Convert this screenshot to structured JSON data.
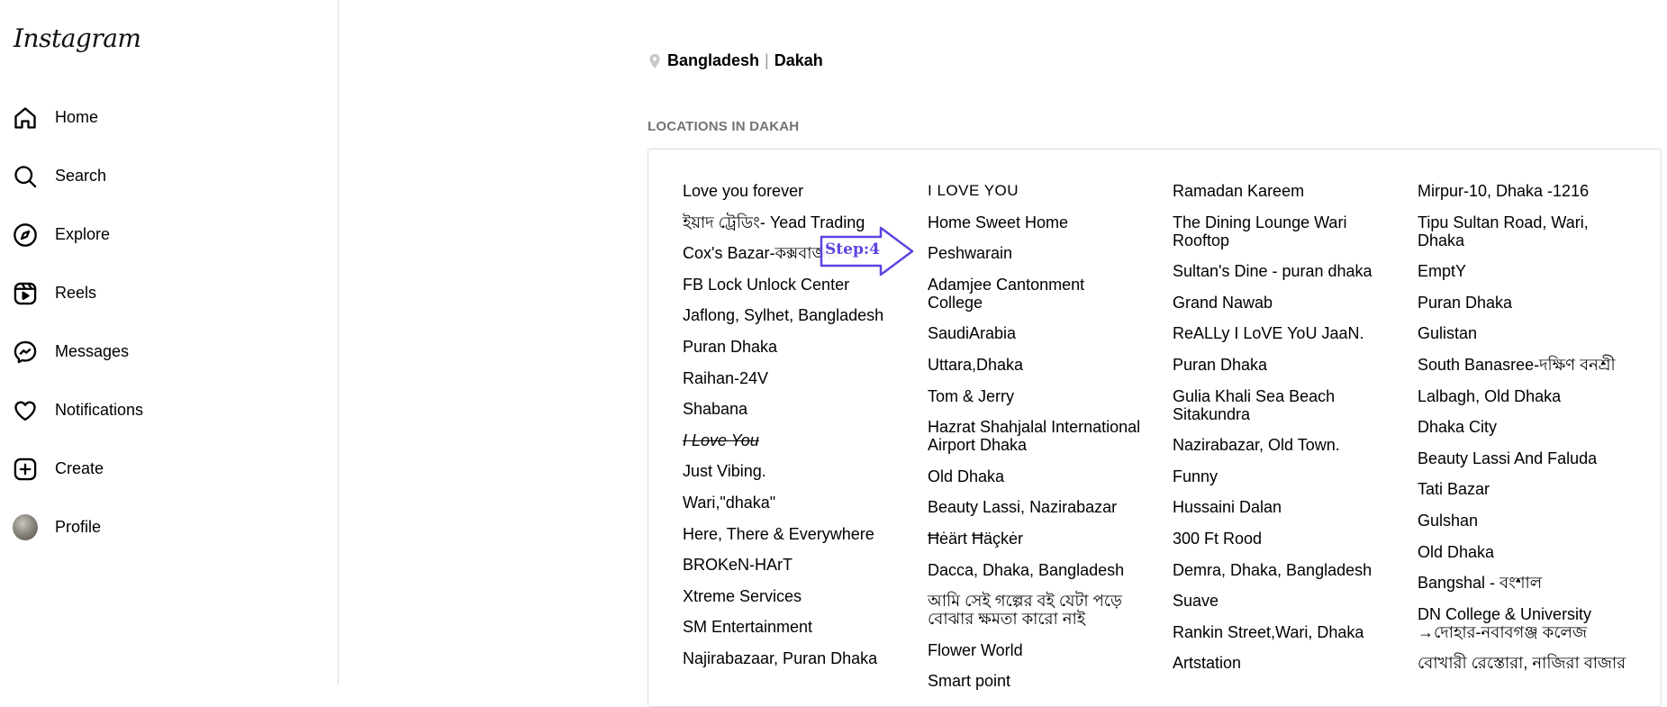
{
  "sidebar": {
    "logo": "Instagram",
    "items": [
      {
        "label": "Home",
        "icon": "home-icon"
      },
      {
        "label": "Search",
        "icon": "search-icon"
      },
      {
        "label": "Explore",
        "icon": "compass-icon"
      },
      {
        "label": "Reels",
        "icon": "reels-icon"
      },
      {
        "label": "Messages",
        "icon": "messenger-icon"
      },
      {
        "label": "Notifications",
        "icon": "heart-icon"
      },
      {
        "label": "Create",
        "icon": "plus-square-icon"
      },
      {
        "label": "Profile",
        "icon": "avatar"
      }
    ]
  },
  "breadcrumb": {
    "country": "Bangladesh",
    "separator": "|",
    "city": "Dakah"
  },
  "section_title": "LOCATIONS IN DAKAH",
  "annotation": {
    "label": "Step:4",
    "color": "#5b45e0"
  },
  "locations": {
    "col0": [
      "Love you forever",
      "ইয়াদ ট্রেডিং- Yead Trading",
      "Cox's Bazar-কক্সবাজার",
      "FB Lock Unlock Center",
      "Jaflong, Sylhet, Bangladesh",
      "Puran Dhaka",
      "Raihan-24V",
      "Shabana",
      "I Love You",
      "Just Vibing.",
      "Wari,\"dhaka\"",
      "Here, There & Everywhere",
      "BROKeN-HArT",
      "Xtreme Services",
      "SM Entertainment",
      "Najirabazaar, Puran Dhaka"
    ],
    "col1": [
      "I LOVE YOU",
      "Home Sweet Home",
      "Peshwarain",
      "Adamjee Cantonment College",
      "SaudiArabia",
      "Uttara,Dhaka",
      "Tom & Jerry",
      "Hazrat Shahjalal International Airport Dhaka",
      "Old Dhaka",
      "Beauty Lassi, Nazirabazar",
      "Ħėärt Ħäçkėr",
      "Dacca, Dhaka, Bangladesh",
      "আমি সেই গল্পের বই যেটা পড়ে বোঝার ক্ষমতা কারো নাই",
      "Flower World",
      "Smart point"
    ],
    "col2": [
      "Ramadan Kareem",
      "The Dining Lounge Wari Rooftop",
      "Sultan's Dine - puran dhaka",
      "Grand Nawab",
      "ReALLy I LoVE YoU JaaN.",
      "Puran Dhaka",
      "Gulia Khali Sea Beach Sitakundra",
      "Nazirabazar, Old Town.",
      "Funny",
      "Hussaini Dalan",
      "300 Ft Rood",
      "Demra, Dhaka, Bangladesh",
      "Suave",
      "Rankin Street,Wari, Dhaka",
      "Artstation"
    ],
    "col3": [
      "Mirpur-10, Dhaka -1216",
      "Tipu Sultan Road, Wari, Dhaka",
      "EmptY",
      "Puran Dhaka",
      "Gulistan",
      "South Banasree-দক্ষিণ বনশ্রী",
      "Lalbagh, Old Dhaka",
      "Dhaka City",
      "Beauty Lassi And Faluda",
      "Tati Bazar",
      "Gulshan",
      "Old Dhaka",
      "Bangshal - বংশাল",
      "DN College & University →দোহার-নবাবগঞ্জ কলেজ",
      "বোখারী রেস্তোরা, নাজিরা বাজার"
    ]
  }
}
